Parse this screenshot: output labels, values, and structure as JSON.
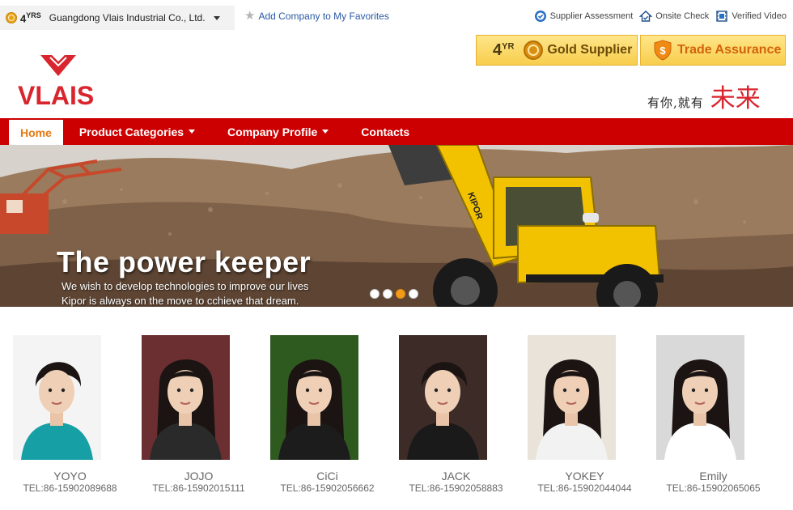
{
  "topbar": {
    "years_num": "4",
    "years_unit": "YRS",
    "company_name": "Guangdong Vlais Industrial Co., Ltd.",
    "favorites_label": "Add Company to My Favorites",
    "links": {
      "supplier_assessment": "Supplier Assessment",
      "onsite_check": "Onsite Check",
      "verified_video": "Verified Video"
    }
  },
  "badges": {
    "years_num": "4",
    "years_unit": "YR",
    "gold_supplier": "Gold Supplier",
    "trade_assurance": "Trade Assurance"
  },
  "header": {
    "logo_text": "VLAIS",
    "slogan_small": "有你,就有",
    "slogan_big": "未来"
  },
  "nav": {
    "home": "Home",
    "product_categories": "Product Categories",
    "company_profile": "Company Profile",
    "contacts": "Contacts"
  },
  "banner": {
    "title": "The power keeper",
    "subtitle_line1": "We wish to develop technologies to improve our lives",
    "subtitle_line2": "Kipor is always on the move to cchieve that dream.",
    "machine_brand": "KIPOR",
    "slide_count": 4,
    "active_slide": 3
  },
  "staff": [
    {
      "name": "YOYO",
      "tel": "TEL:86-15902089688"
    },
    {
      "name": "JOJO",
      "tel": "TEL:86-15902015111"
    },
    {
      "name": "CiCi",
      "tel": "TEL:86-15902056662"
    },
    {
      "name": "JACK",
      "tel": "TEL:86-15902058883"
    },
    {
      "name": "YOKEY",
      "tel": "TEL:86-15902044044"
    },
    {
      "name": "Emily",
      "tel": "TEL:86-15902065065"
    }
  ],
  "colors": {
    "brand_red": "#cc0000",
    "logo_red": "#d9252e",
    "home_orange": "#e47911",
    "gold_badge": "#f7cd4c",
    "link_blue": "#2a59a5"
  }
}
